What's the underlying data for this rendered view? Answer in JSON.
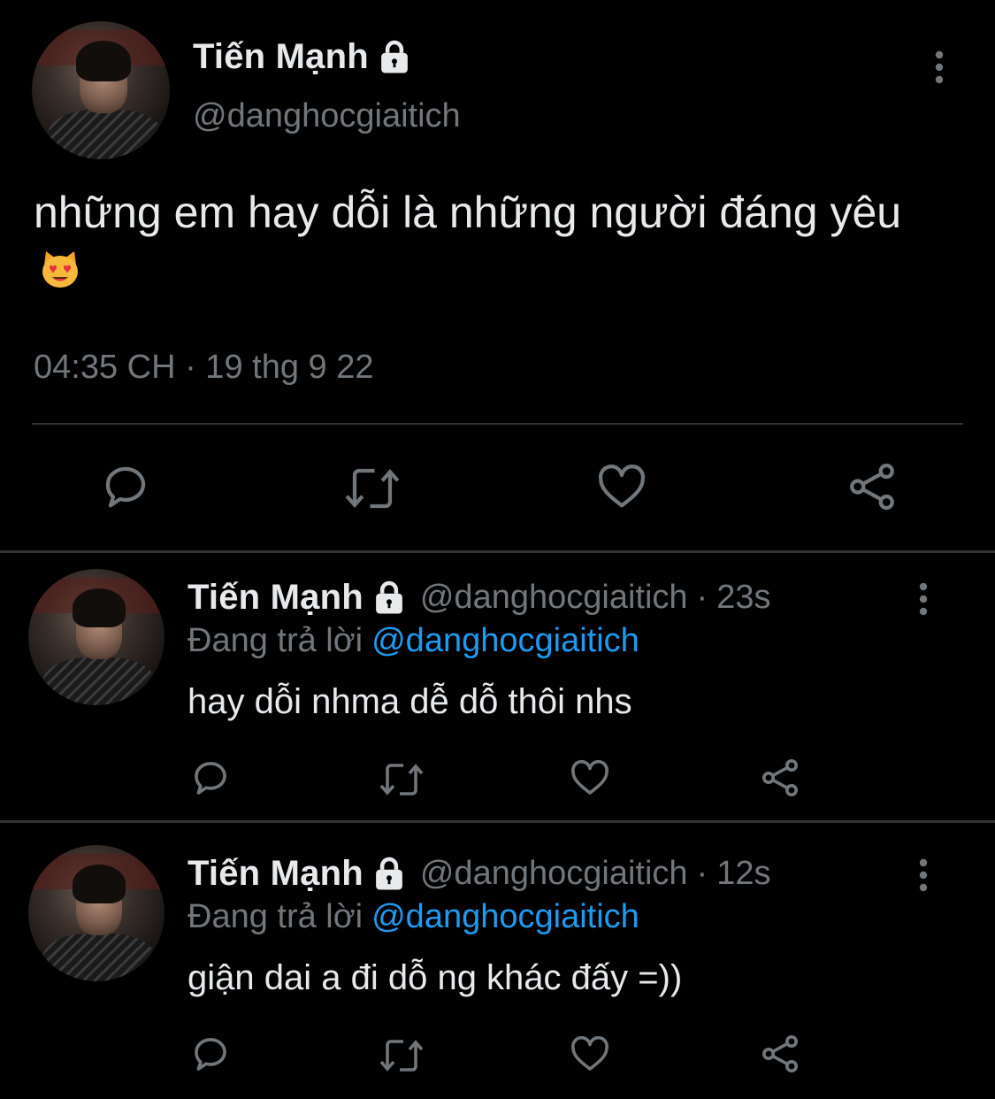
{
  "main_tweet": {
    "display_name": "Tiến Mạnh",
    "handle": "@danghocgiaitich",
    "text": "những em hay dỗi là những người đáng yêu",
    "emoji": "smiling-cat-with-heart-eyes",
    "timestamp": "04:35 CH · 19 thg 9 22"
  },
  "replies": [
    {
      "display_name": "Tiến Mạnh",
      "handle": "@danghocgiaitich",
      "separator": "·",
      "time": "23s",
      "replying_label": "Đang trả lời",
      "replying_to": "@danghocgiaitich",
      "text": "hay dỗi nhma dễ dỗ thôi nhs"
    },
    {
      "display_name": "Tiến Mạnh",
      "handle": "@danghocgiaitich",
      "separator": "·",
      "time": "12s",
      "replying_label": "Đang trả lời",
      "replying_to": "@danghocgiaitich",
      "text": "giận dai a đi dỗ ng khác đấy =))"
    }
  ],
  "colors": {
    "background": "#000000",
    "text_primary": "#e7e9ea",
    "text_secondary": "#71767b",
    "link": "#1d9bf0",
    "divider": "#2f3336"
  },
  "icons": [
    "lock-icon",
    "more-icon",
    "reply-icon",
    "retweet-icon",
    "like-icon",
    "share-icon"
  ]
}
